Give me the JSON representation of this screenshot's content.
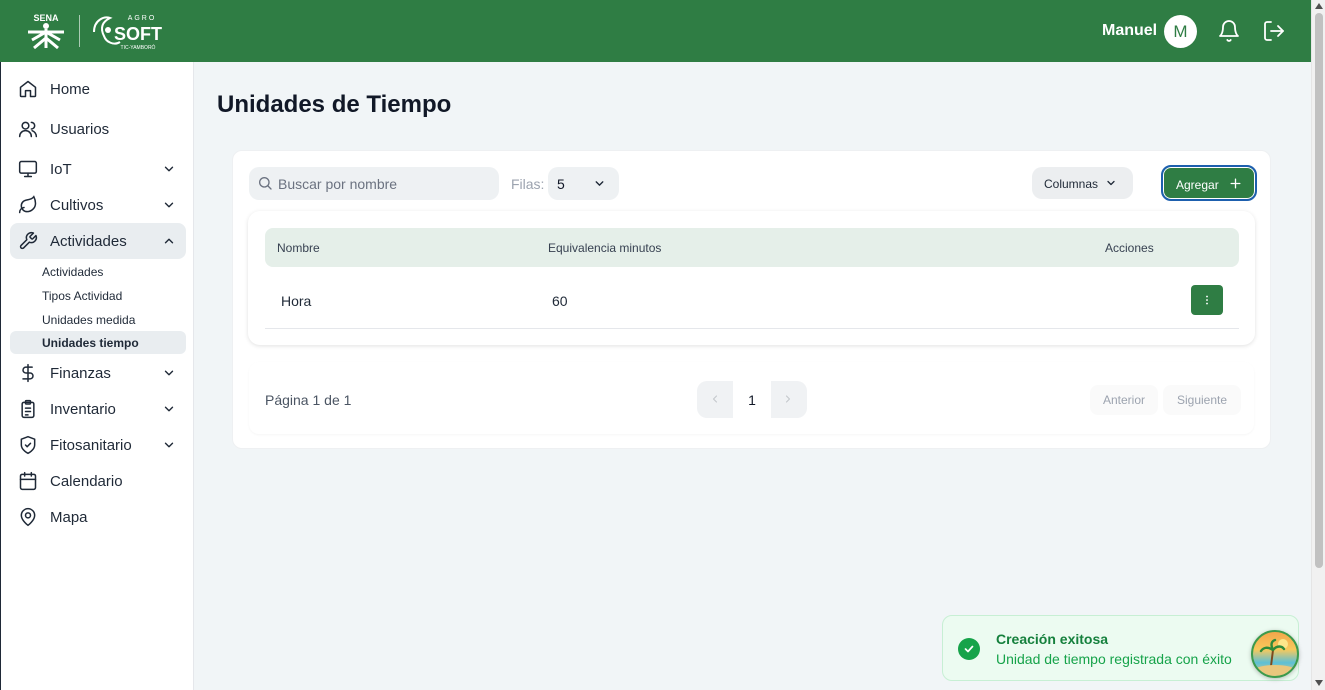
{
  "header": {
    "logo_sena": "SENA",
    "logo_agro": "AGRO",
    "logo_soft": "SOFT",
    "logo_sub": "TIC-YAMBORÓ",
    "user_name": "Manuel",
    "avatar_initial": "M",
    "icons": [
      "bell-icon",
      "logout-icon"
    ]
  },
  "sidebar": {
    "items": [
      {
        "label": "Home",
        "icon": "home-icon"
      },
      {
        "label": "Usuarios",
        "icon": "users-icon"
      },
      {
        "label": "IoT",
        "icon": "monitor-icon",
        "expandable": true
      },
      {
        "label": "Cultivos",
        "icon": "leaf-icon",
        "expandable": true
      },
      {
        "label": "Actividades",
        "icon": "wrench-icon",
        "expandable": true,
        "expanded": true
      },
      {
        "label": "Finanzas",
        "icon": "dollar-icon",
        "expandable": true
      },
      {
        "label": "Inventario",
        "icon": "clipboard-icon",
        "expandable": true
      },
      {
        "label": "Fitosanitario",
        "icon": "shield-icon",
        "expandable": true
      },
      {
        "label": "Calendario",
        "icon": "calendar-icon"
      },
      {
        "label": "Mapa",
        "icon": "map-pin-icon"
      }
    ],
    "subitems": [
      "Actividades",
      "Tipos Actividad",
      "Unidades medida",
      "Unidades tiempo"
    ],
    "active_subitem": "Unidades tiempo"
  },
  "page": {
    "title": "Unidades de Tiempo"
  },
  "toolbar": {
    "search_placeholder": "Buscar por nombre",
    "filas_label": "Filas:",
    "filas_value": "5",
    "columns_label": "Columnas",
    "add_label": "Agregar"
  },
  "table": {
    "headers": [
      "Nombre",
      "Equivalencia minutos",
      "Acciones"
    ],
    "rows": [
      {
        "nombre": "Hora",
        "equivalencia": "60"
      }
    ]
  },
  "pagination": {
    "info": "Página 1 de 1",
    "current_page": "1",
    "prev_label": "Anterior",
    "next_label": "Siguiente"
  },
  "toast": {
    "title": "Creación exitosa",
    "message": "Unidad de tiempo registrada con éxito"
  },
  "colors": {
    "brand": "#2f7d44",
    "success": "#16a34a"
  }
}
